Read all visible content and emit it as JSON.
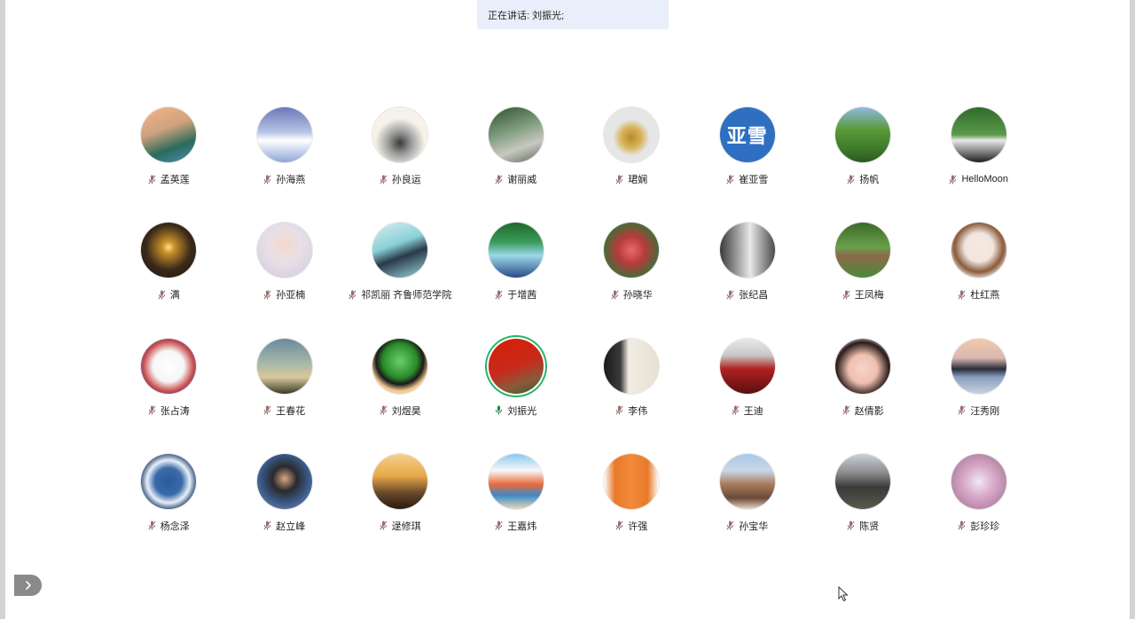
{
  "banner": {
    "speaking_text": "正在讲话: 刘振光;"
  },
  "colors": {
    "speaking_ring": "#29b36a",
    "mic_muted": "#9a7070",
    "mic_active": "#1b8a4c",
    "banner_bg": "#e9effa"
  },
  "participants": [
    {
      "name": "孟英莲",
      "muted": true,
      "avatar": "landscape-pine-icon",
      "bg": "linear-gradient(160deg,#f3b58a 0%,#cfa27e 40%,#2b6b5c 70%,#4a8fb5 100%)"
    },
    {
      "name": "孙海燕",
      "muted": true,
      "avatar": "sky-clouds-icon",
      "bg": "linear-gradient(180deg,#6a78b8 0%,#b6c4e6 45%,#ffffff 60%,#8ea6d8 100%)"
    },
    {
      "name": "孙良运",
      "muted": true,
      "avatar": "ink-painting-icon",
      "bg": "radial-gradient(circle at 50% 65%,#3a3a3a 0%,#9a9a9a 25%,#f6f2ea 55%)"
    },
    {
      "name": "谢丽威",
      "muted": true,
      "avatar": "park-path-icon",
      "bg": "linear-gradient(160deg,#2f4f2f 0%,#7a9a7a 40%,#c8c8c0 70%,#5a6a5a 100%)"
    },
    {
      "name": "珺娴",
      "muted": true,
      "avatar": "golden-figure-icon",
      "bg": "radial-gradient(circle at 50% 55%,#b88a2a 0%,#d8b35a 25%,#e6e6e6 45%)"
    },
    {
      "name": "崔亚雪",
      "muted": true,
      "avatar": "initials-avatar",
      "initials": "亚雪",
      "bg": "#2f6fc2"
    },
    {
      "name": "扬帆",
      "muted": true,
      "avatar": "forest-icon",
      "bg": "linear-gradient(180deg,#8fb8e0 0%,#5a9a3a 40%,#3f7a2a 75%,#2a5a1f 100%)"
    },
    {
      "name": "HelloMoon",
      "muted": true,
      "avatar": "panda-icon",
      "bg": "linear-gradient(180deg,#2f6a2a 0%,#5a9a4a 50%,#e8e8e8 60%,#202020 100%)"
    },
    {
      "name": "满",
      "muted": true,
      "avatar": "sunset-icon",
      "bg": "radial-gradient(circle at 50% 45%,#ffe08a 0%,#c8902a 15%,#3a2a1a 55%,#1a1410 100%)"
    },
    {
      "name": "孙亚楠",
      "muted": true,
      "avatar": "portrait-woman-icon",
      "bg": "radial-gradient(circle at 50% 40%,#f4d8c8 0%,#e8e0e8 40%,#cfc8d8 100%)"
    },
    {
      "name": "祁凯丽 齐鲁师范学院",
      "muted": true,
      "avatar": "pool-diver-icon",
      "bg": "linear-gradient(160deg,#d8eef0 0%,#8ad0d8 40%,#2a3a4a 60%,#9adce0 100%)"
    },
    {
      "name": "于增茜",
      "muted": true,
      "avatar": "waterfall-icon",
      "bg": "linear-gradient(180deg,#1f6a2a 0%,#3a9a5a 35%,#9ad8e8 60%,#2a4a8a 100%)"
    },
    {
      "name": "孙晓华",
      "muted": true,
      "avatar": "pavilion-blossom-icon",
      "bg": "radial-gradient(circle at 50% 50%,#e86a6a 0%,#b83a3a 35%,#4a6a3a 70%,#2a3a2a 100%)"
    },
    {
      "name": "张纪昌",
      "muted": true,
      "avatar": "door-icon",
      "bg": "linear-gradient(90deg,#3a3a3a 0%,#c8c8c8 45%,#e8e8e8 55%,#4a4a4a 100%)"
    },
    {
      "name": "王凤梅",
      "muted": true,
      "avatar": "garden-icon",
      "bg": "linear-gradient(180deg,#3a6a2a 0%,#6aa04a 45%,#8a6a4a 60%,#4a8a3a 100%)"
    },
    {
      "name": "杜红燕",
      "muted": true,
      "avatar": "cartoon-girl-icon",
      "bg": "radial-gradient(circle at 50% 45%,#f8e8dc 0%,#f0e6e0 35%,#8a5a3a 60%,#f4f0ec 80%)"
    },
    {
      "name": "张占涛",
      "muted": true,
      "avatar": "seal-logo-icon",
      "bg": "radial-gradient(circle at 50% 50%,#ffffff 0%,#f6f6f6 40%,#c84a4a 65%,#3a5aa8 80%,#ffffff 100%)"
    },
    {
      "name": "王春花",
      "muted": true,
      "avatar": "dusk-sky-icon",
      "bg": "linear-gradient(180deg,#6a8aa0 0%,#a8b8a8 45%,#d8c89a 70%,#3a3a2a 100%)"
    },
    {
      "name": "刘煜昊",
      "muted": true,
      "avatar": "cartoon-boy-icon",
      "bg": "radial-gradient(circle at 50% 40%,#6ad06a 0%,#2a8a2a 40%,#1a1a1a 55%,#f4c890 70%,#f6e0a0 100%)"
    },
    {
      "name": "刘振光",
      "muted": false,
      "speaking": true,
      "avatar": "flag-tree-icon",
      "bg": "linear-gradient(160deg,#d81e06 0%,#c82a1a 50%,#8a5a3a 75%,#3a5a2a 100%)"
    },
    {
      "name": "李伟",
      "muted": true,
      "avatar": "calligraphy-icon",
      "bg": "linear-gradient(90deg,#1a1a1a 0%,#3a3a3a 30%,#f0ece4 45%,#e8e0d0 100%)"
    },
    {
      "name": "王迪",
      "muted": true,
      "avatar": "red-dress-icon",
      "bg": "linear-gradient(180deg,#e8e8e8 0%,#c8c8c8 30%,#b02020 55%,#5a1010 100%)"
    },
    {
      "name": "赵倩影",
      "muted": true,
      "avatar": "selfie-woman-icon",
      "bg": "radial-gradient(circle at 50% 55%,#f6d4c8 0%,#efc0b0 35%,#2a1a1a 65%,#f4f0ee 85%)"
    },
    {
      "name": "汪秀刚",
      "muted": true,
      "avatar": "lake-pavilion-icon",
      "bg": "linear-gradient(180deg,#f4c8a8 0%,#d8b8b0 35%,#2a2a3a 55%,#8aa0c0 70%,#c8d0e0 100%)"
    },
    {
      "name": "杨念泽",
      "muted": true,
      "avatar": "earth-icon",
      "bg": "radial-gradient(circle at 50% 50%,#2a5a9a 0%,#3a6aa8 35%,#e8f0f8 55%,#1a3a6a 75%,#0a1a2a 100%)"
    },
    {
      "name": "赵立峰",
      "muted": true,
      "avatar": "portrait-man-icon",
      "bg": "radial-gradient(circle at 50% 45%,#d8a888 0%,#2a2a2a 30%,#3a5a8a 60%,#8a9ab0 100%)"
    },
    {
      "name": "逯修琪",
      "muted": true,
      "avatar": "deer-sunset-icon",
      "bg": "linear-gradient(180deg,#f4d08a 0%,#e8a84a 40%,#6a4a2a 70%,#2a1a10 100%)"
    },
    {
      "name": "王嘉炜",
      "muted": true,
      "avatar": "beach-man-icon",
      "bg": "linear-gradient(180deg,#8ac8f0 0%,#f8f8f8 30%,#e86a3a 55%,#3a8ac8 75%,#e8d8b8 100%)"
    },
    {
      "name": "许强",
      "muted": true,
      "avatar": "orange-bag-icon",
      "bg": "linear-gradient(90deg,#ffffff 0%,#e87a2a 20%,#f08a3a 50%,#e87a2a 80%,#ffffff 100%)"
    },
    {
      "name": "孙宝华",
      "muted": true,
      "avatar": "temple-tree-icon",
      "bg": "linear-gradient(180deg,#a8c8e8 0%,#c8d8e8 30%,#a87a5a 55%,#6a4a3a 80%,#e8d8c8 100%)"
    },
    {
      "name": "陈贤",
      "muted": true,
      "avatar": "building-portrait-icon",
      "bg": "linear-gradient(180deg,#c8d0d8 0%,#8a8a8a 35%,#3a3a3a 60%,#5a5a4a 100%)"
    },
    {
      "name": "彭珍珍",
      "muted": true,
      "avatar": "pink-abstract-icon",
      "bg": "radial-gradient(circle at 50% 50%,#f0e8f4 0%,#d8a8c8 40%,#b88aa8 70%,#e8d8e8 100%)"
    }
  ]
}
